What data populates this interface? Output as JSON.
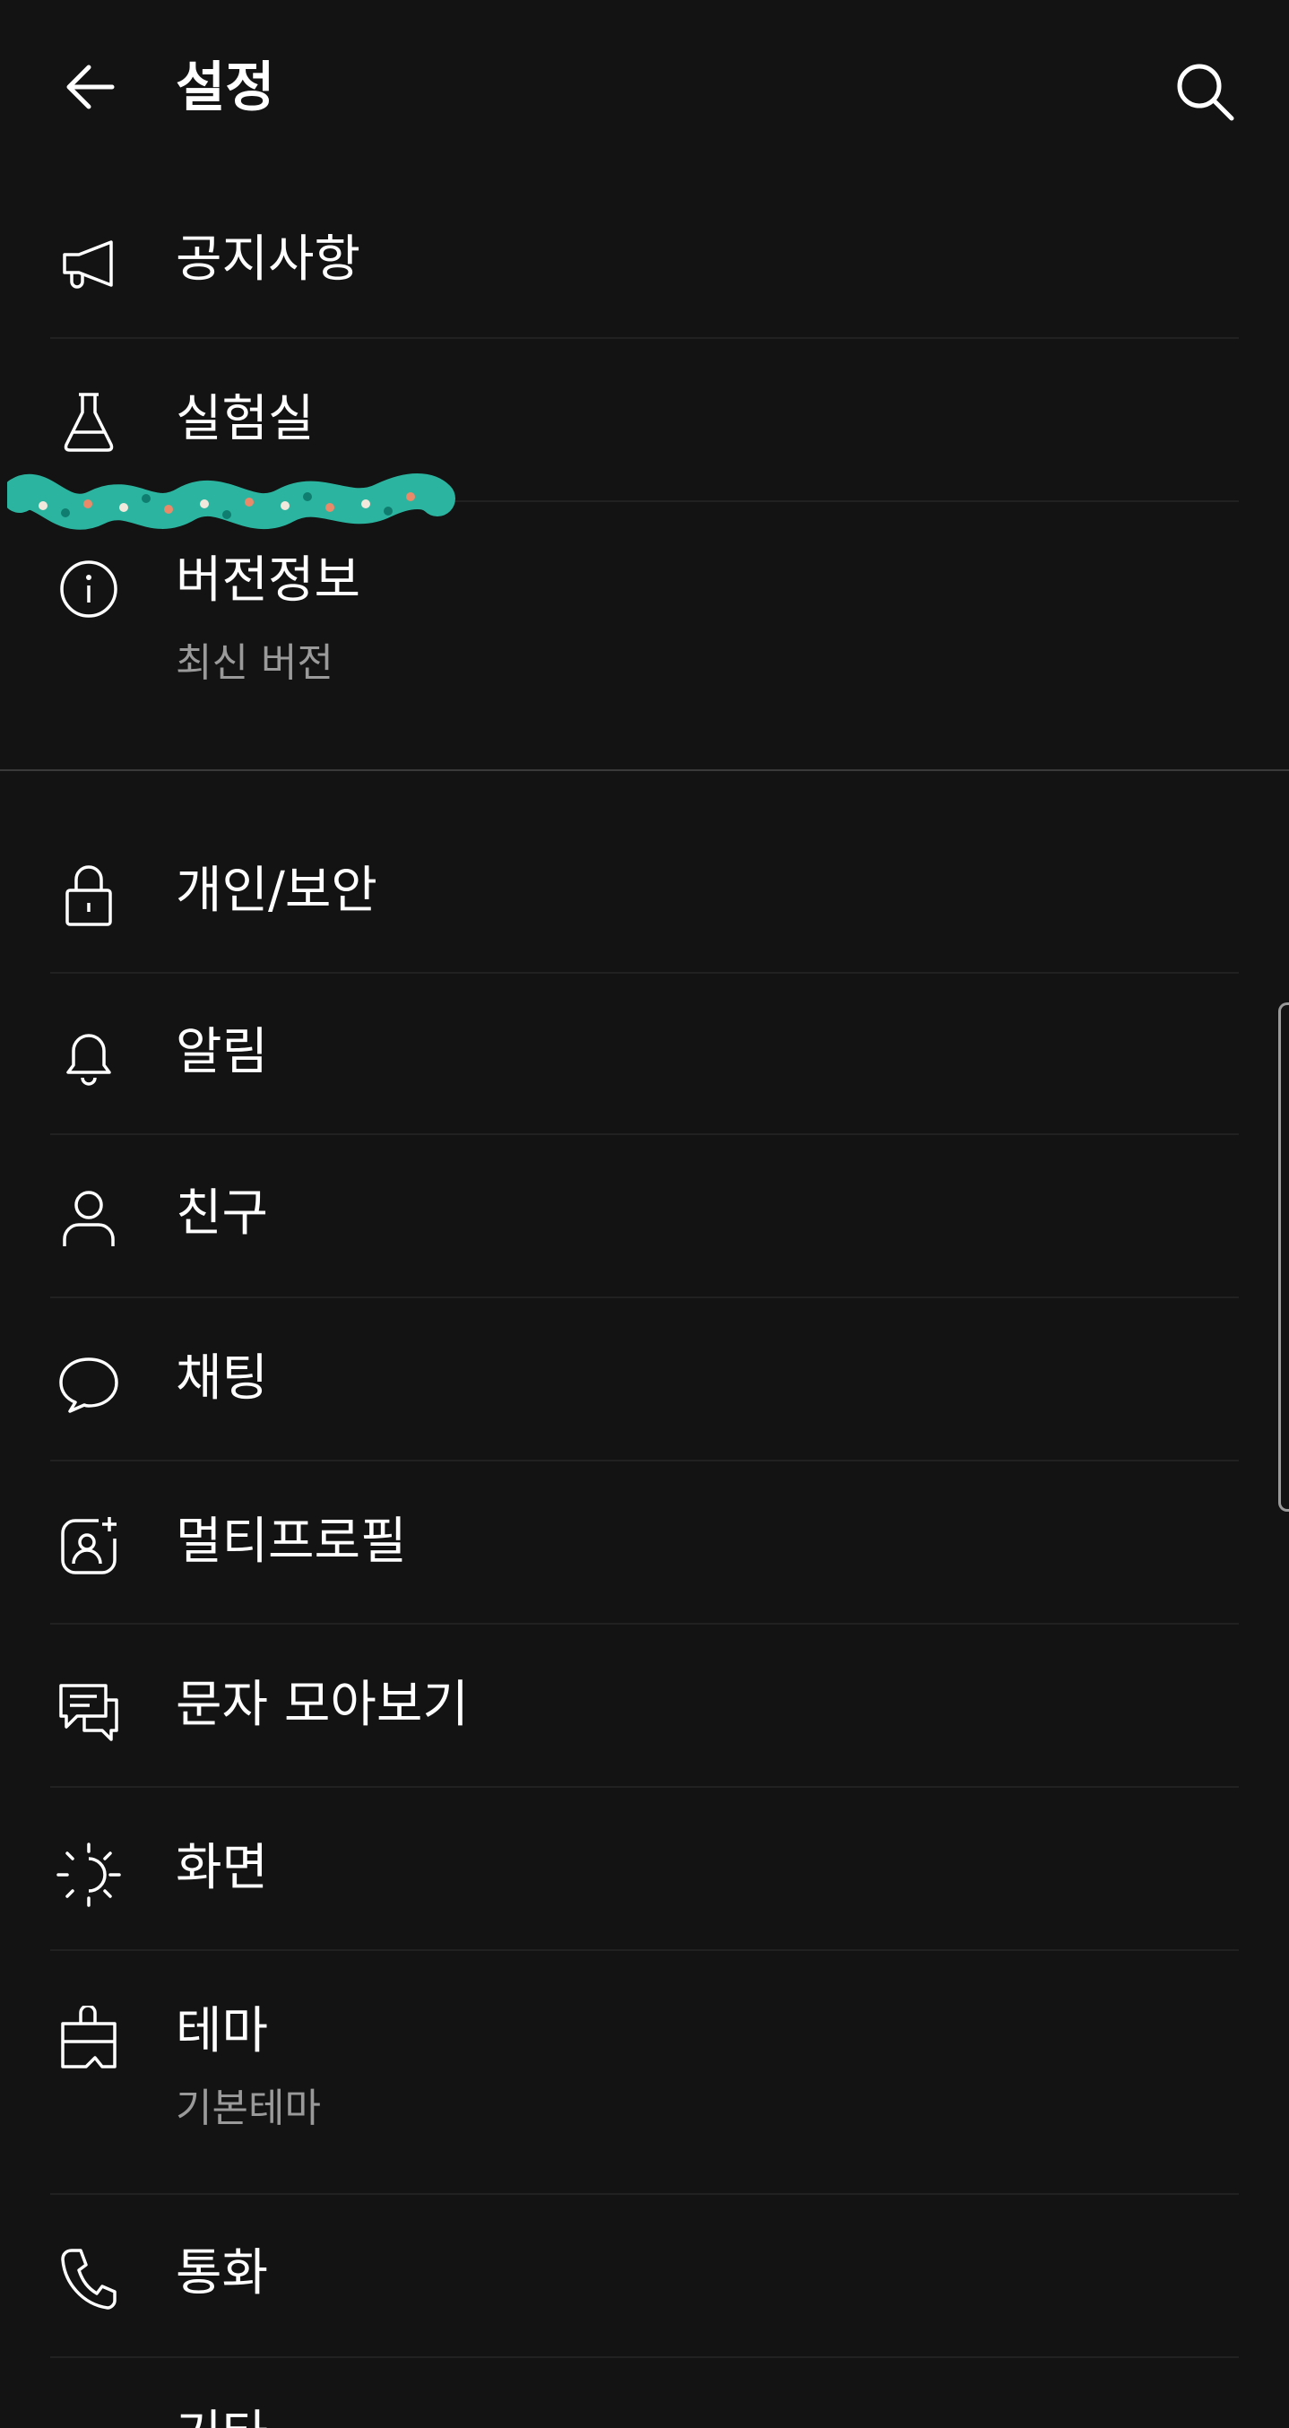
{
  "header": {
    "title": "설정",
    "back_icon": "arrow-left-icon",
    "search_icon": "search-icon"
  },
  "items": [
    {
      "label": "공지사항",
      "sub": "",
      "icon": "megaphone-icon"
    },
    {
      "label": "실험실",
      "sub": "",
      "icon": "flask-icon"
    },
    {
      "label": "버전정보",
      "sub": "최신 버전",
      "icon": "info-icon"
    },
    {
      "label": "개인/보안",
      "sub": "",
      "icon": "lock-icon"
    },
    {
      "label": "알림",
      "sub": "",
      "icon": "bell-icon"
    },
    {
      "label": "친구",
      "sub": "",
      "icon": "person-icon"
    },
    {
      "label": "채팅",
      "sub": "",
      "icon": "chat-bubble-icon"
    },
    {
      "label": "멀티프로필",
      "sub": "",
      "icon": "multi-profile-icon"
    },
    {
      "label": "문자 모아보기",
      "sub": "",
      "icon": "messages-icon"
    },
    {
      "label": "화면",
      "sub": "",
      "icon": "brightness-icon"
    },
    {
      "label": "테마",
      "sub": "기본테마",
      "icon": "theme-brush-icon"
    },
    {
      "label": "통화",
      "sub": "",
      "icon": "phone-icon"
    },
    {
      "label": "기타",
      "sub": "",
      "icon": "etc-icon"
    }
  ],
  "colors": {
    "background": "#131313",
    "text": "#ffffff",
    "subtext": "#9a9a9a",
    "divider": "#212121",
    "scribble": "#2bb5a0"
  }
}
